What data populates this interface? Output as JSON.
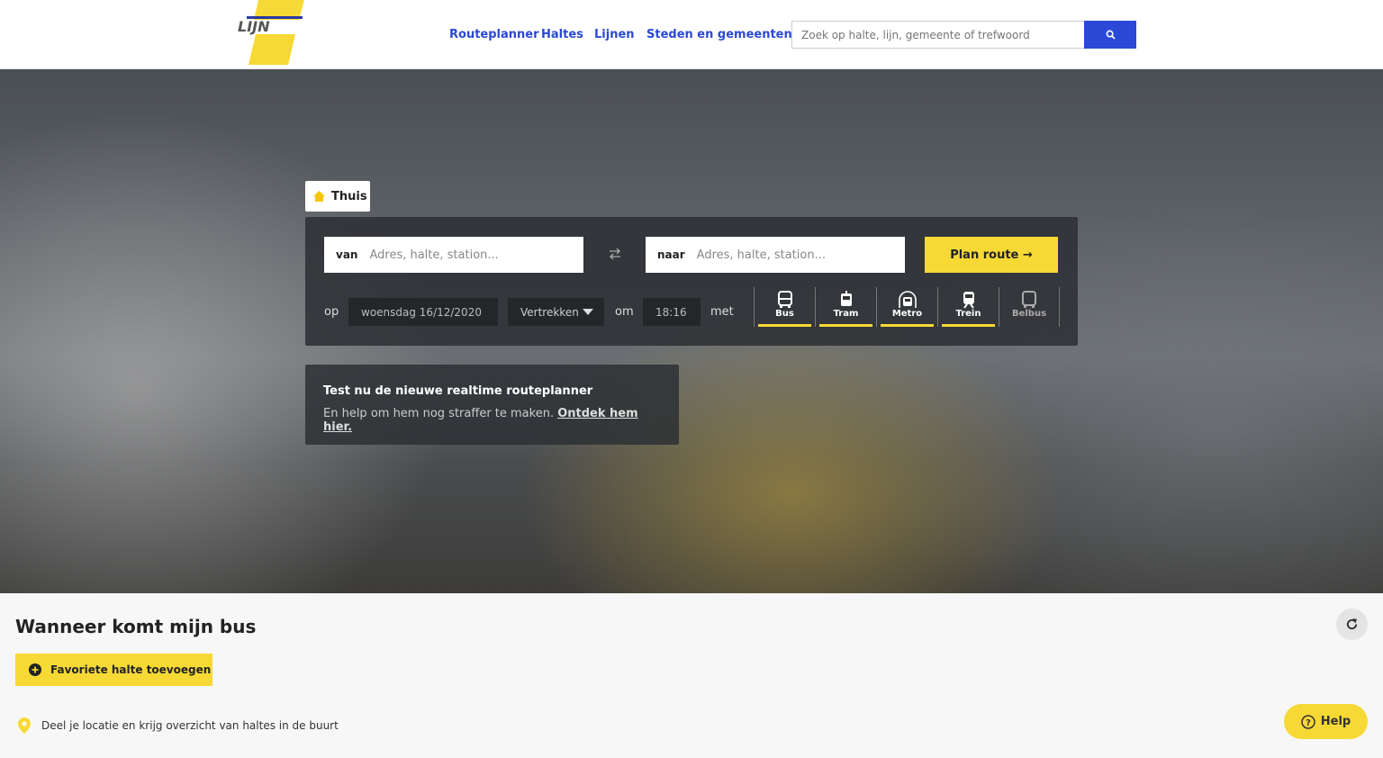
{
  "header": {
    "logo_text": "DE LIJN",
    "nav": [
      "Routeplanner",
      "Haltes",
      "Lijnen",
      "Steden en gemeenten"
    ],
    "search_placeholder": "Zoek op halte, lijn, gemeente of trefwoord"
  },
  "planner": {
    "tab": "Thuis",
    "from_label": "van",
    "from_placeholder": "Adres, halte, station...",
    "to_label": "naar",
    "to_placeholder": "Adres, halte, station...",
    "plan_button": "Plan route",
    "date_label": "op",
    "date": "woensdag 16/12/2020",
    "mode_select": "Vertrekken",
    "time_label": "om",
    "time": "18:16",
    "with_label": "met",
    "modes": [
      {
        "label": "Bus",
        "active": true
      },
      {
        "label": "Tram",
        "active": true
      },
      {
        "label": "Metro",
        "active": true
      },
      {
        "label": "Trein",
        "active": true
      },
      {
        "label": "Belbus",
        "active": false
      }
    ]
  },
  "promo": {
    "title": "Test nu de nieuwe realtime routeplanner",
    "text": "En help om hem nog straffer te maken.",
    "link": "Ontdek hem hier."
  },
  "section": {
    "title": "Wanneer komt mijn bus",
    "add_favorite": "Favoriete halte toevoegen",
    "location_text": "Deel je locatie en krijg overzicht van haltes in de buurt"
  },
  "help": "Help",
  "colors": {
    "brand_yellow": "#f7d935",
    "link_blue": "#2b49d6"
  }
}
